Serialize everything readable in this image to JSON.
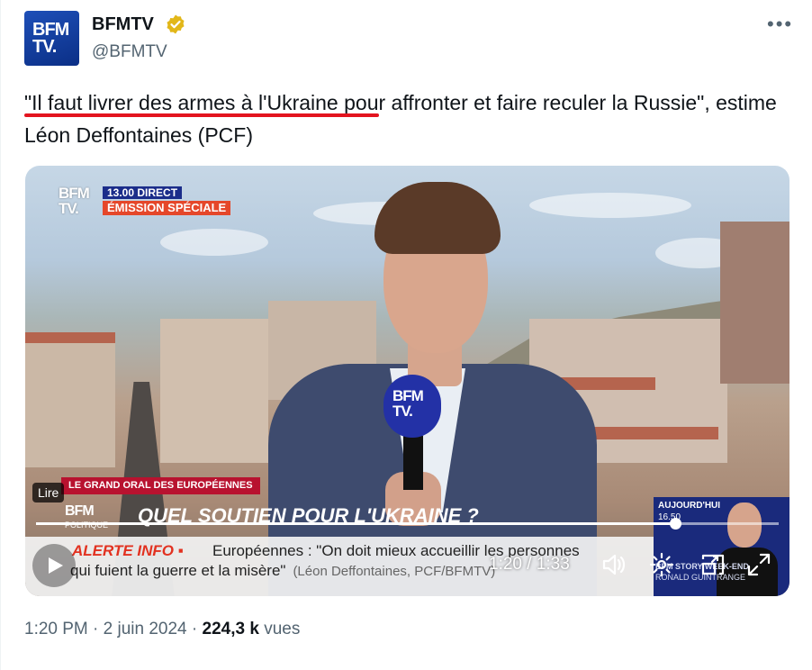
{
  "author": {
    "name": "BFMTV",
    "handle": "@BFMTV",
    "avatar_text_line1": "BFM",
    "avatar_text_line2": "TV."
  },
  "icons": {
    "verified": "verified-badge-icon",
    "more": "more-icon",
    "play": "play-icon",
    "volume": "volume-icon",
    "settings": "settings-icon",
    "pip": "pip-icon",
    "fullscreen": "fullscreen-icon"
  },
  "more_label": "•••",
  "tweet": {
    "text": "\"Il faut livrer des armes à l'Ukraine pour affronter et faire reculer la Russie\", estime Léon Deffontaines (PCF)"
  },
  "video": {
    "channel_logo_line1": "BFM",
    "channel_logo_line2": "TV.",
    "live_tag": "13.00  DIRECT",
    "special_tag": "ÉMISSION SPÉCIALE",
    "segment_label": "LE GRAND ORAL DES EUROPÉENNES",
    "lire_label": "Lire",
    "program_logo": "BFM",
    "program_logo_sub": "POLITIQUE",
    "headline": "QUEL SOUTIEN POUR L'UKRAINE ?",
    "mic_logo_line1": "BFM",
    "mic_logo_line2": "TV.",
    "ticker_label": "ALERTE INFO ▪",
    "ticker_line1": "Européennes : \"On doit mieux accueillir les personnes",
    "ticker_line2": "qui fuient la guerre et la misère\"",
    "ticker_source": "(Léon Deffontaines, PCF/BFMTV)",
    "side_panel_title": "AUJOURD'HUI",
    "side_panel_time": "16.50",
    "side_panel_story": "BFM STORY WEEK-END",
    "side_panel_guest": "RONALD GUINTRANGE",
    "current_time": "1:20",
    "duration": "1:33",
    "time_readout": "1:20 / 1:33",
    "progress_fraction": 0.86
  },
  "meta": {
    "time": "1:20 PM",
    "separator": " · ",
    "date": "2 juin 2024",
    "views_count": "224,3 k",
    "views_label": "vues"
  },
  "colors": {
    "underline": "#e3141f",
    "bfm_blue": "#1b2d8a",
    "alert_red": "#e23120",
    "text_secondary": "#536471"
  }
}
